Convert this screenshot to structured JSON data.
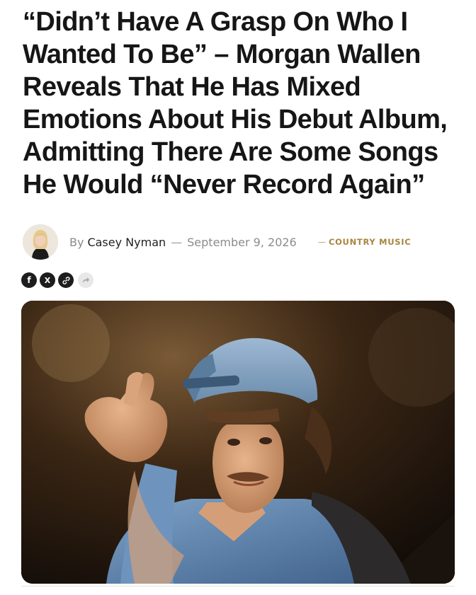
{
  "article": {
    "headline": "“Didn’t Have A Grasp On Who I Wanted To Be” – Morgan Wallen Reveals That He Has Mixed Emotions About His Debut Album, Admitting There Are Some Songs He Would “Never Record Again”",
    "byline": {
      "prefix": "By",
      "author": "Casey Nyman",
      "separator": "—",
      "date": "September 9, 2026",
      "category_separator": "—",
      "category": "COUNTRY MUSIC",
      "category_color": "#a88540"
    },
    "share": {
      "buttons": [
        {
          "icon": "facebook-icon",
          "glyph": "f"
        },
        {
          "icon": "x-icon",
          "glyph": "X"
        },
        {
          "icon": "link-icon"
        },
        {
          "icon": "share-arrow-icon"
        }
      ]
    },
    "hero_image": {
      "description_icon": "photo-image"
    }
  }
}
